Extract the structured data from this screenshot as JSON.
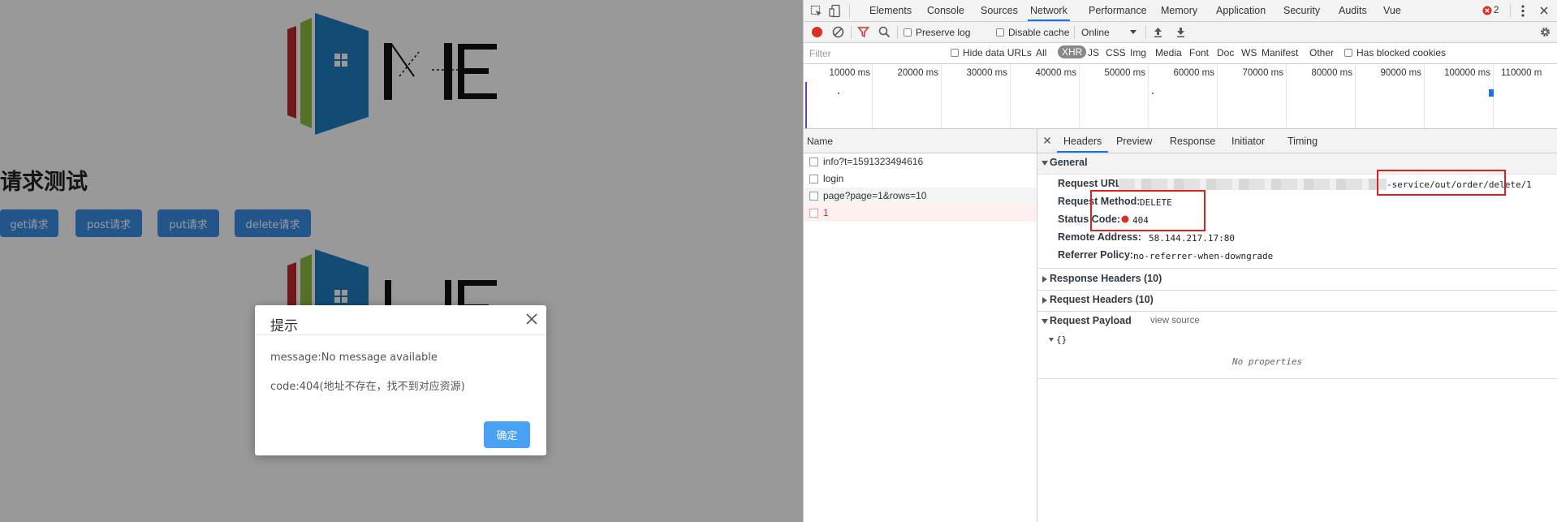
{
  "app": {
    "page_title": "请求测试",
    "buttons": {
      "get": "get请求",
      "post": "post请求",
      "put": "put请求",
      "delete": "delete请求"
    }
  },
  "dialog": {
    "title": "提示",
    "line1": "message:No message available",
    "line2": "code:404(地址不存在，找不到对应资源)",
    "ok": "确定"
  },
  "devtools": {
    "tabs": [
      "Elements",
      "Console",
      "Sources",
      "Network",
      "Performance",
      "Memory",
      "Application",
      "Security",
      "Audits",
      "Vue"
    ],
    "active_tab": "Network",
    "error_count": "2",
    "toolbar": {
      "preserve_log": "Preserve log",
      "disable_cache": "Disable cache",
      "throttle": "Online"
    },
    "filter": {
      "placeholder": "Filter",
      "hide_data_urls": "Hide data URLs",
      "types": [
        "All",
        "XHR",
        "JS",
        "CSS",
        "Img",
        "Media",
        "Font",
        "Doc",
        "WS",
        "Manifest",
        "Other"
      ],
      "active_type": "XHR",
      "has_blocked_cookies": "Has blocked cookies"
    },
    "timeline_ticks": [
      "10000 ms",
      "20000 ms",
      "30000 ms",
      "40000 ms",
      "50000 ms",
      "60000 ms",
      "70000 ms",
      "80000 ms",
      "90000 ms",
      "100000 ms",
      "110000 m"
    ],
    "name_header": "Name",
    "requests": [
      {
        "name": "info?t=1591323494616",
        "error": false
      },
      {
        "name": "login",
        "error": false
      },
      {
        "name": "page?page=1&rows=10",
        "error": false
      },
      {
        "name": "1",
        "error": true
      }
    ],
    "detail_tabs": [
      "Headers",
      "Preview",
      "Response",
      "Initiator",
      "Timing"
    ],
    "detail_active": "Headers",
    "general": {
      "title": "General",
      "request_url_key": "Request URL:",
      "request_url_value": "-service/out/order/delete/1",
      "request_method_key": "Request Method:",
      "request_method_value": "DELETE",
      "status_code_key": "Status Code:",
      "status_code_value": "404",
      "remote_address_key": "Remote Address:",
      "remote_address_value": "58.144.217.17:80",
      "referrer_policy_key": "Referrer Policy:",
      "referrer_policy_value": "no-referrer-when-downgrade"
    },
    "response_headers": "Response Headers (10)",
    "request_headers": "Request Headers (10)",
    "request_payload": "Request Payload",
    "view_source": "view source",
    "payload_object": "{}",
    "no_properties": "No properties",
    "colors": {
      "accent": "#1a73e8",
      "record": "#d93025",
      "highlight": "#e02020",
      "error_row": "#fff0f0"
    }
  }
}
